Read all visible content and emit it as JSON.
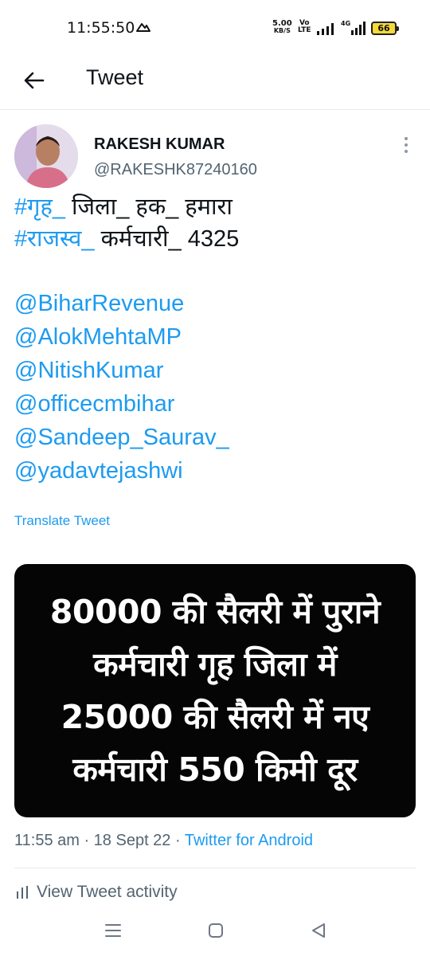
{
  "status_bar": {
    "time": "11:55:50",
    "net_speed_value": "5.00",
    "net_speed_unit": "KB/S",
    "volte_top": "Vo",
    "volte_mid": "LTE",
    "volte_bottom": "LTE",
    "network_type": "4G",
    "battery_level": "66"
  },
  "header": {
    "title": "Tweet"
  },
  "tweet": {
    "display_name": "RAKESH KUMAR",
    "handle": "@RAKESHK87240160",
    "hashtag_line1_link": "#गृह_",
    "hashtag_line1_rest": " जिला_ हक_ हमारा",
    "hashtag_line2_link": "#राजस्व_",
    "hashtag_line2_rest": " कर्मचारी_ 4325",
    "mentions": [
      "@BiharRevenue",
      "@AlokMehtaMP",
      "@NitishKumar",
      "@officecmbihar",
      "@Sandeep_Saurav_",
      "@yadavtejashwi"
    ],
    "translate_label": "Translate Tweet",
    "image_text": [
      "80000 की सैलरी में पुराने",
      "कर्मचारी गृह जिला में",
      "25000 की सैलरी में नए",
      "कर्मचारी 550 किमी दूर"
    ],
    "meta_time_date": "11:55 am · 18 Sept 22 · ",
    "meta_source": "Twitter for Android",
    "activity_label": "View Tweet activity"
  },
  "colors": {
    "accent": "#1d9bf0",
    "muted": "#536471",
    "text": "#0f1419",
    "battery": "#f6d93a"
  },
  "icons": {
    "back": "arrow-left-icon",
    "more": "more-vertical-icon",
    "activity": "bar-chart-icon",
    "nav_menu": "menu-icon",
    "nav_home": "square-home-icon",
    "nav_back": "triangle-back-icon"
  }
}
